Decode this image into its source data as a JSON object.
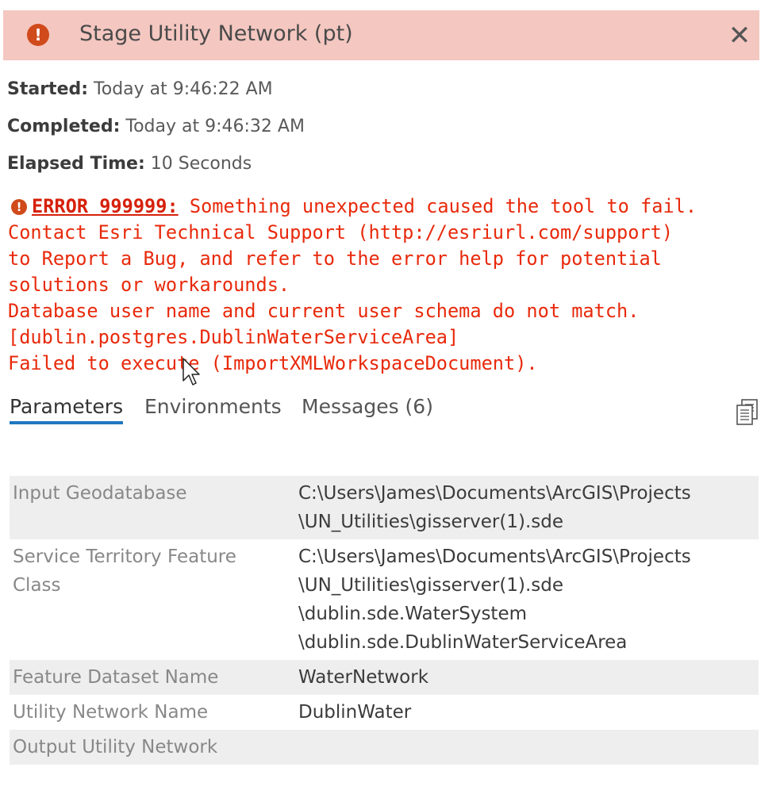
{
  "header": {
    "title": "Stage Utility Network (pt)",
    "status_icon": "error-icon",
    "close_glyph": "✕",
    "bg_color": "#f4c7c0"
  },
  "info": {
    "started_label": "Started:",
    "started_value": "Today at 9:46:22 AM",
    "completed_label": "Completed:",
    "completed_value": "Today at 9:46:32 AM",
    "elapsed_label": "Elapsed Time:",
    "elapsed_value": "10 Seconds"
  },
  "error": {
    "code": "ERROR 999999:",
    "line1_rest": " Something unexpected caused the tool to fail.",
    "line2": "Contact Esri Technical Support (http://esriurl.com/support)",
    "line3": "to Report a Bug, and refer to the error help for potential",
    "line4": "solutions or workarounds.",
    "line5": "Database user name and current user schema do not match.",
    "line6": "[dublin.postgres.DublinWaterServiceArea]",
    "line7": "Failed to execute (ImportXMLWorkspaceDocument).",
    "color": "#e8290b"
  },
  "tabs": [
    {
      "label": "Parameters",
      "active": true
    },
    {
      "label": "Environments",
      "active": false
    },
    {
      "label": "Messages (6)",
      "active": false
    }
  ],
  "copy_icon": "copy-icon",
  "parameters": [
    {
      "name": "Input Geodatabase",
      "value_lines": [
        "C:\\Users\\James\\Documents\\ArcGIS\\Projects",
        "\\UN_Utilities\\gisserver(1).sde"
      ]
    },
    {
      "name_lines": [
        "Service Territory Feature",
        "Class"
      ],
      "value_lines": [
        "C:\\Users\\James\\Documents\\ArcGIS\\Projects",
        "\\UN_Utilities\\gisserver(1).sde",
        "\\dublin.sde.WaterSystem",
        "\\dublin.sde.DublinWaterServiceArea"
      ]
    },
    {
      "name": "Feature Dataset Name",
      "value_lines": [
        "WaterNetwork"
      ]
    },
    {
      "name": "Utility Network Name",
      "value_lines": [
        "DublinWater"
      ]
    },
    {
      "name": "Output Utility Network",
      "value_lines": [
        ""
      ]
    }
  ]
}
